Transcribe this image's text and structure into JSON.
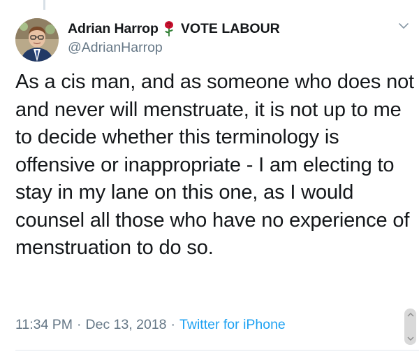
{
  "author": {
    "display_name": "Adrian Harrop",
    "badge_emoji": "rose-icon",
    "tagline": "VOTE LABOUR",
    "handle": "@AdrianHarrop"
  },
  "tweet": {
    "text": "As a cis man, and as someone who does not and never will menstruate, it is not up to me to decide whether this terminology is offensive or inappropriate - I am electing to stay in my lane on this one, as I would counsel all those who have no experience of menstruation to do so.",
    "time": "11:34 PM",
    "date": "Dec 13, 2018",
    "separator": "·",
    "source": "Twitter for iPhone"
  },
  "colors": {
    "text": "#14171a",
    "secondary": "#657786",
    "link": "#1da1f2",
    "rose": "#c8102e"
  },
  "icons": [
    "chevron-down-icon",
    "rose-icon",
    "scroll-up-icon",
    "scroll-down-icon"
  ]
}
